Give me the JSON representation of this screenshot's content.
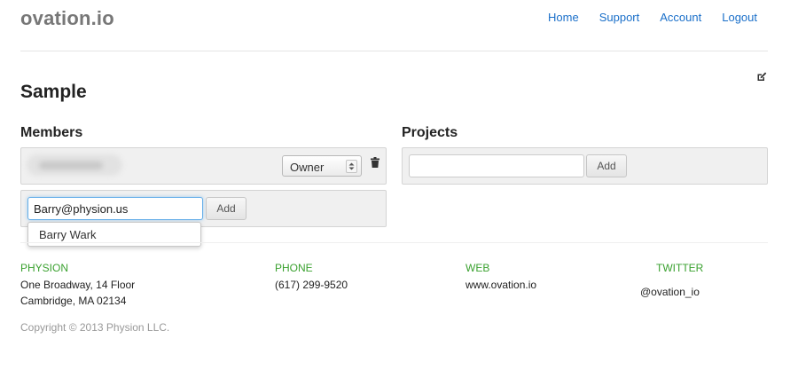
{
  "brand": "ovation.io",
  "nav": {
    "home": "Home",
    "support": "Support",
    "account": "Account",
    "logout": "Logout"
  },
  "page": {
    "title": "Sample",
    "edit_icon": "edit-icon"
  },
  "members": {
    "title": "Members",
    "rows": [
      {
        "name": "",
        "role": "Owner",
        "delete_icon": "trash-icon"
      }
    ],
    "add": {
      "email_value": "Barry@physion.us",
      "button_label": "Add",
      "suggestions": [
        "Barry Wark"
      ]
    }
  },
  "projects": {
    "title": "Projects",
    "input_value": "",
    "button_label": "Add"
  },
  "footer": {
    "physion": {
      "heading": "PHYSION",
      "line1": "One Broadway, 14 Floor",
      "line2": "Cambridge, MA 02134"
    },
    "phone": {
      "heading": "PHONE",
      "value": "(617) 299-9520"
    },
    "web": {
      "heading": "WEB",
      "value": "www.ovation.io"
    },
    "twitter": {
      "heading": "TWITTER",
      "value": "@ovation_io"
    },
    "copyright": "Copyright © 2013 Physion LLC."
  },
  "colors": {
    "link": "#1a6fc9",
    "footer_heading": "#3aa12f",
    "well_bg": "#f0f0f0"
  }
}
